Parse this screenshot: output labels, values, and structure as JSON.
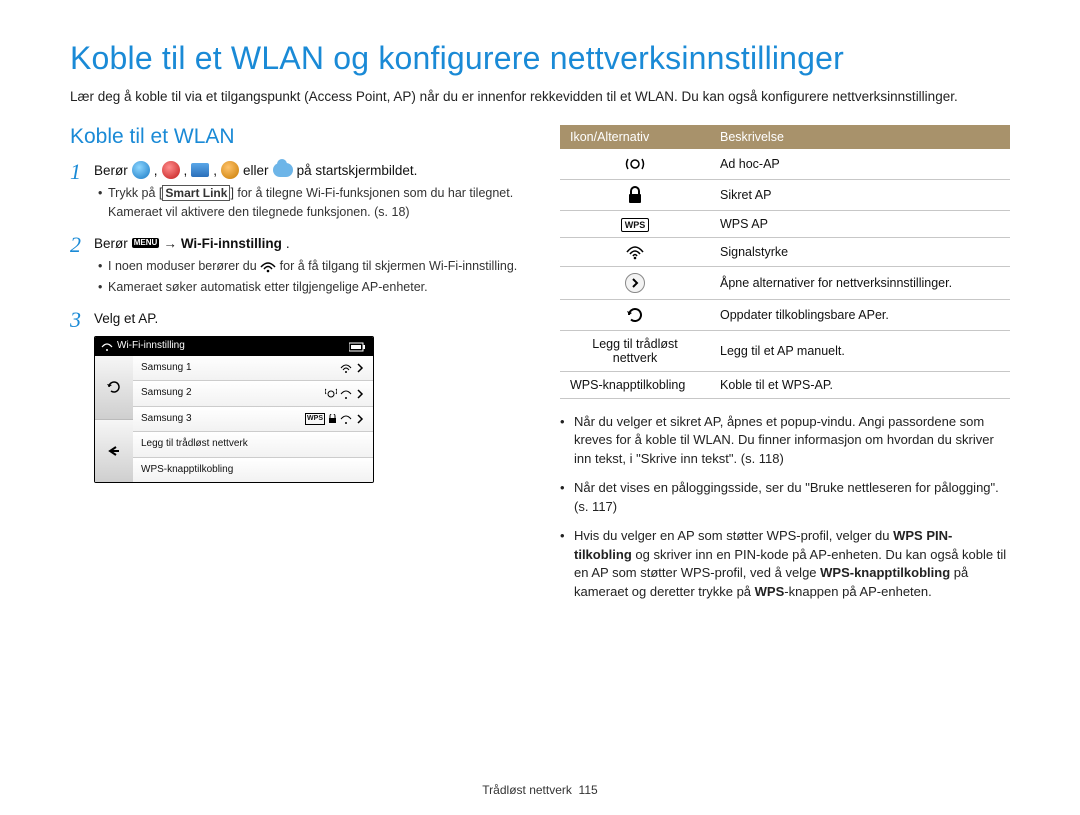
{
  "title": "Koble til et WLAN og konfigurere nettverksinnstillinger",
  "intro": "Lær deg å koble til via et tilgangspunkt (Access Point, AP) når du er innenfor rekkevidden til et WLAN. Du kan også konfigurere nettverksinnstillinger.",
  "subtitle": "Koble til et WLAN",
  "steps": {
    "s1": {
      "num": "1",
      "pre": "Berør",
      "mid": "eller",
      "post": "på startskjermbildet.",
      "bullet1a": "Trykk på [",
      "bullet1b": "Smart Link",
      "bullet1c": "] for å tilegne Wi-Fi-funksjonen som du har tilegnet. Kameraet vil aktivere den tilegnede funksjonen. (s. 18)"
    },
    "s2": {
      "num": "2",
      "pre": "Berør",
      "arrow": "→",
      "wifi": "Wi-Fi-innstilling",
      "dot": ".",
      "bullet1a": "I noen moduser berører du",
      "bullet1b": "for å få tilgang til skjermen Wi-Fi-innstilling.",
      "bullet2": "Kameraet søker automatisk etter tilgjengelige AP-enheter."
    },
    "s3": {
      "num": "3",
      "text": "Velg et AP."
    }
  },
  "device": {
    "title": "Wi-Fi-innstilling",
    "rows": {
      "r1": "Samsung 1",
      "r2": "Samsung 2",
      "r3": "Samsung 3",
      "r4": "Legg til trådløst nettverk",
      "r5": "WPS-knapptilkobling"
    }
  },
  "table": {
    "h1": "Ikon/Alternativ",
    "h2": "Beskrivelse",
    "r1": "Ad hoc-AP",
    "r2": "Sikret AP",
    "r3": "WPS AP",
    "r4": "Signalstyrke",
    "r5": "Åpne alternativer for nettverksinnstillinger.",
    "r6": "Oppdater tilkoblingsbare APer.",
    "r7label": "Legg til trådløst nettverk",
    "r7": "Legg til et AP manuelt.",
    "r8label": "WPS-knapptilkobling",
    "r8": "Koble til et WPS-AP."
  },
  "right_bullets": {
    "b1": "Når du velger et sikret AP, åpnes et popup-vindu. Angi passordene som kreves for å koble til WLAN. Du finner informasjon om hvordan du skriver inn tekst, i \"Skrive inn tekst\". (s. 118)",
    "b2": "Når det vises en påloggingsside, ser du \"Bruke nettleseren for pålogging\". (s. 117)",
    "b3a": "Hvis du velger en AP som støtter WPS-profil, velger du ",
    "b3b": "WPS PIN-tilkobling",
    "b3c": " og skriver inn en PIN-kode på AP-enheten. Du kan også koble til en AP som støtter WPS-profil, ved å velge ",
    "b3d": "WPS-knapptilkobling",
    "b3e": " på kameraet og deretter trykke på ",
    "b3f": "WPS",
    "b3g": "-knappen på AP-enheten."
  },
  "footer": {
    "section": "Trådløst nettverk",
    "page": "115"
  }
}
